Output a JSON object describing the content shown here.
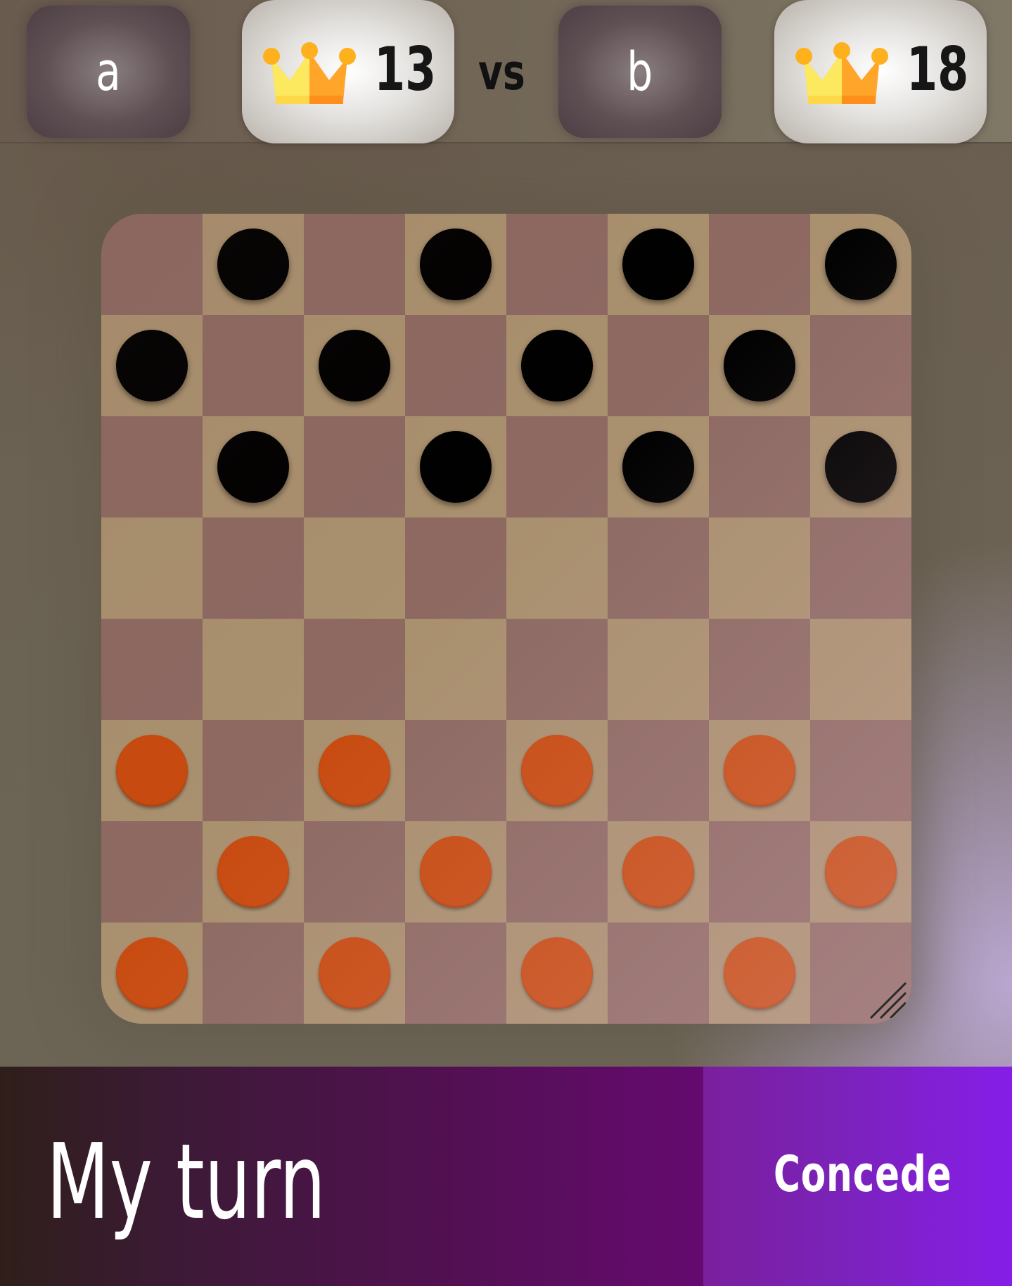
{
  "header": {
    "player1": {
      "name": "a",
      "score": "13"
    },
    "vs_label": "vs",
    "player2": {
      "name": "b",
      "score": "18"
    }
  },
  "board": {
    "size": 8,
    "light_square_color": "#a9906e",
    "dark_square_color": "#8d6962",
    "black_piece_color": "#000000",
    "orange_piece_color": "#c84b10",
    "rows": [
      [
        "",
        "black",
        "",
        "black",
        "",
        "black",
        "",
        "black"
      ],
      [
        "black",
        "",
        "black",
        "",
        "black",
        "",
        "black",
        ""
      ],
      [
        "",
        "black",
        "",
        "black",
        "",
        "black",
        "",
        "black"
      ],
      [
        "",
        "",
        "",
        "",
        "",
        "",
        "",
        ""
      ],
      [
        "",
        "",
        "",
        "",
        "",
        "",
        "",
        ""
      ],
      [
        "orange",
        "",
        "orange",
        "",
        "orange",
        "",
        "orange",
        ""
      ],
      [
        "",
        "orange",
        "",
        "orange",
        "",
        "orange",
        "",
        "orange"
      ],
      [
        "orange",
        "",
        "orange",
        "",
        "orange",
        "",
        "orange",
        ""
      ]
    ]
  },
  "status": {
    "turn_text": "My turn"
  },
  "actions": {
    "concede_label": "Concede"
  },
  "icons": {
    "crown": "crown-icon",
    "resize": "resize-grip-icon"
  }
}
